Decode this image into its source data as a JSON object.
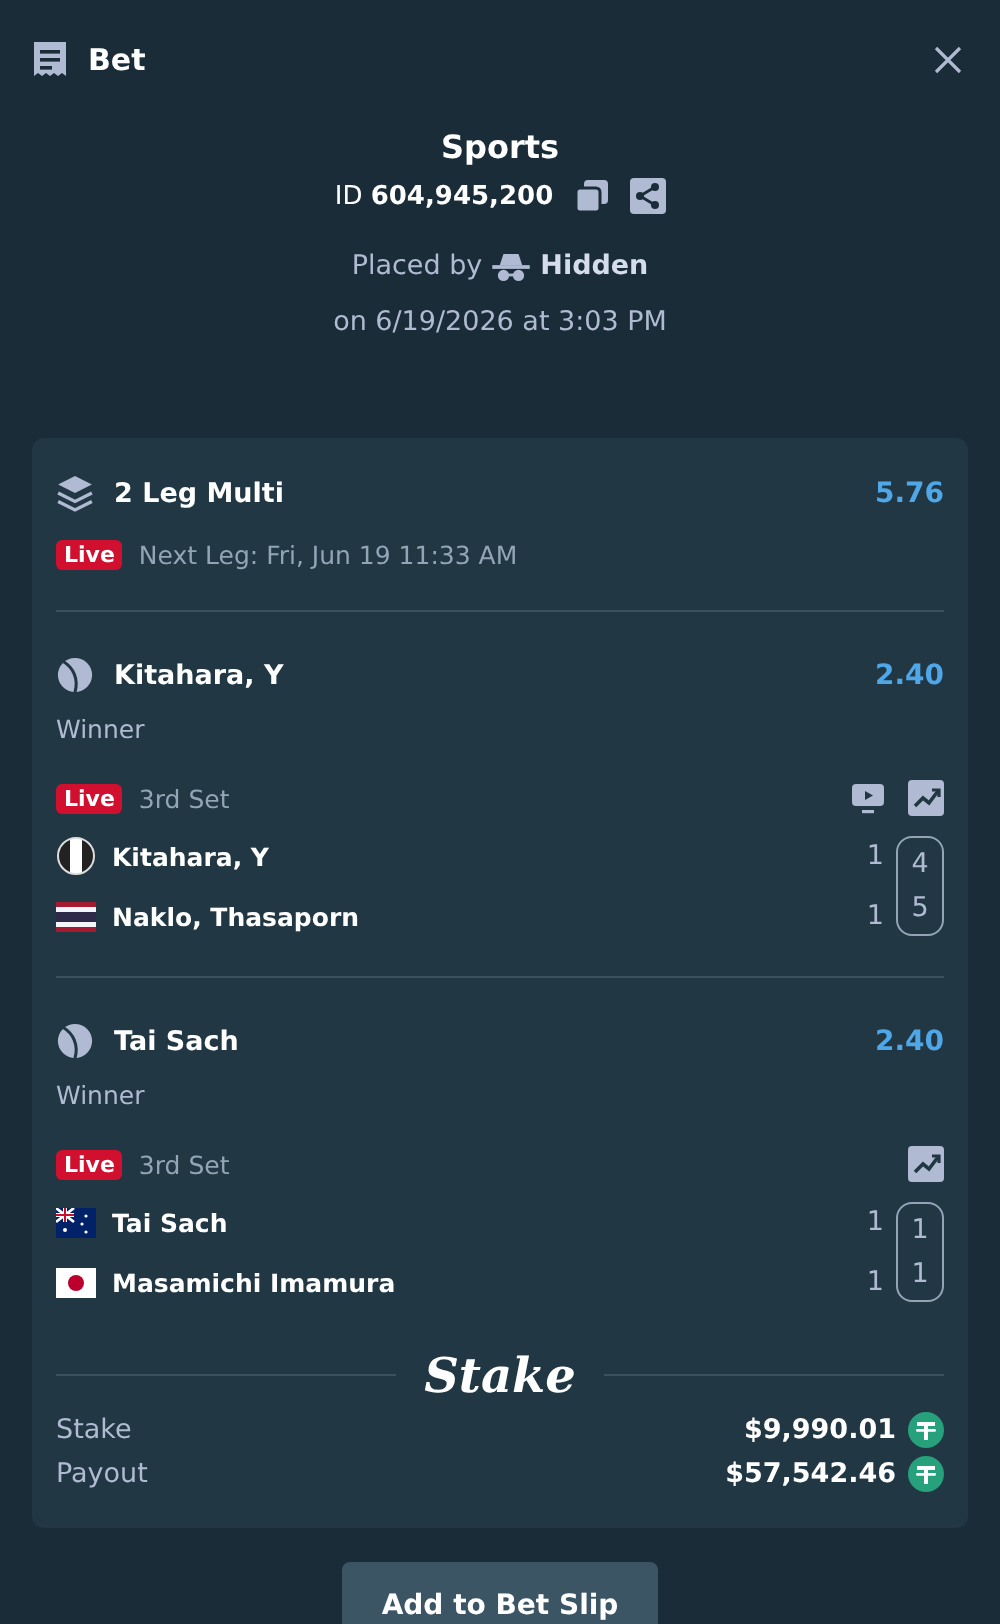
{
  "header": {
    "title": "Bet"
  },
  "bet": {
    "category": "Sports",
    "id_label": "ID",
    "id": "604,945,200",
    "placed_by_label": "Placed by",
    "placed_by": "Hidden",
    "placed_on": "on 6/19/2026 at 3:03 PM"
  },
  "multi": {
    "title": "2 Leg Multi",
    "odds": "5.76",
    "live_badge": "Live",
    "next_leg": "Next Leg: Fri, Jun 19 11:33 AM"
  },
  "legs": [
    {
      "selection": "Kitahara, Y",
      "odds": "2.40",
      "market": "Winner",
      "live_badge": "Live",
      "status": "3rd Set",
      "tools": [
        {
          "kind": "tv"
        },
        {
          "kind": "chart"
        }
      ],
      "players": [
        {
          "name": "Kitahara, Y",
          "flag": {
            "kind": "striped"
          },
          "sets": "1",
          "games": "4"
        },
        {
          "name": "Naklo, Thasaporn",
          "flag": {
            "kind": "thailand"
          },
          "sets": "1",
          "games": "5"
        }
      ]
    },
    {
      "selection": "Tai Sach",
      "odds": "2.40",
      "market": "Winner",
      "live_badge": "Live",
      "status": "3rd Set",
      "tools": [
        {
          "kind": "chart"
        }
      ],
      "players": [
        {
          "name": "Tai Sach",
          "flag": {
            "kind": "australia"
          },
          "sets": "1",
          "games": "1"
        },
        {
          "name": "Masamichi Imamura",
          "flag": {
            "kind": "japan"
          },
          "sets": "1",
          "games": "1"
        }
      ]
    }
  ],
  "brand": "Stake",
  "totals": [
    {
      "label": "Stake",
      "amount": "$9,990.01"
    },
    {
      "label": "Payout",
      "amount": "$57,542.46"
    }
  ],
  "action": "Add to Bet Slip"
}
